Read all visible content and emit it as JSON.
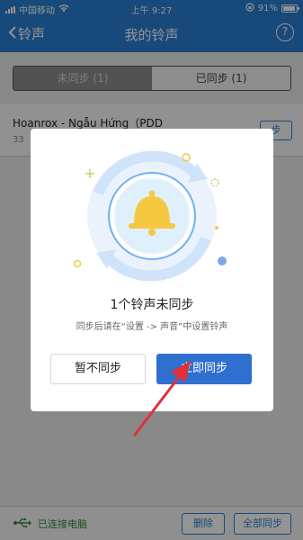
{
  "status_bar": {
    "carrier": "中国移动",
    "time": "上午 9:27",
    "battery": "91%"
  },
  "nav": {
    "back_label": "铃声",
    "title": "我的铃声",
    "help_glyph": "?"
  },
  "tabs": [
    {
      "label": "未同步 (1)",
      "active": true
    },
    {
      "label": "已同步 (1)",
      "active": false
    }
  ],
  "list": {
    "items": [
      {
        "title": "Hoanrox - Ngẫu Hứng（PDD",
        "meta": "33",
        "action_label": "步"
      }
    ]
  },
  "bottom_bar": {
    "connection_status": "已连接电脑",
    "delete_label": "删除",
    "sync_all_label": "全部同步"
  },
  "dialog": {
    "title": "1个铃声未同步",
    "description": "同步后请在“设置 -> 声音”中设置铃声",
    "cancel_label": "暂不同步",
    "confirm_label": "立即同步"
  },
  "colors": {
    "brand": "#2a7fd4",
    "primary_button": "#2f6fd0",
    "annotation_arrow": "#e0303a",
    "bell": "#f5c842",
    "connected": "#2a8a3a"
  }
}
